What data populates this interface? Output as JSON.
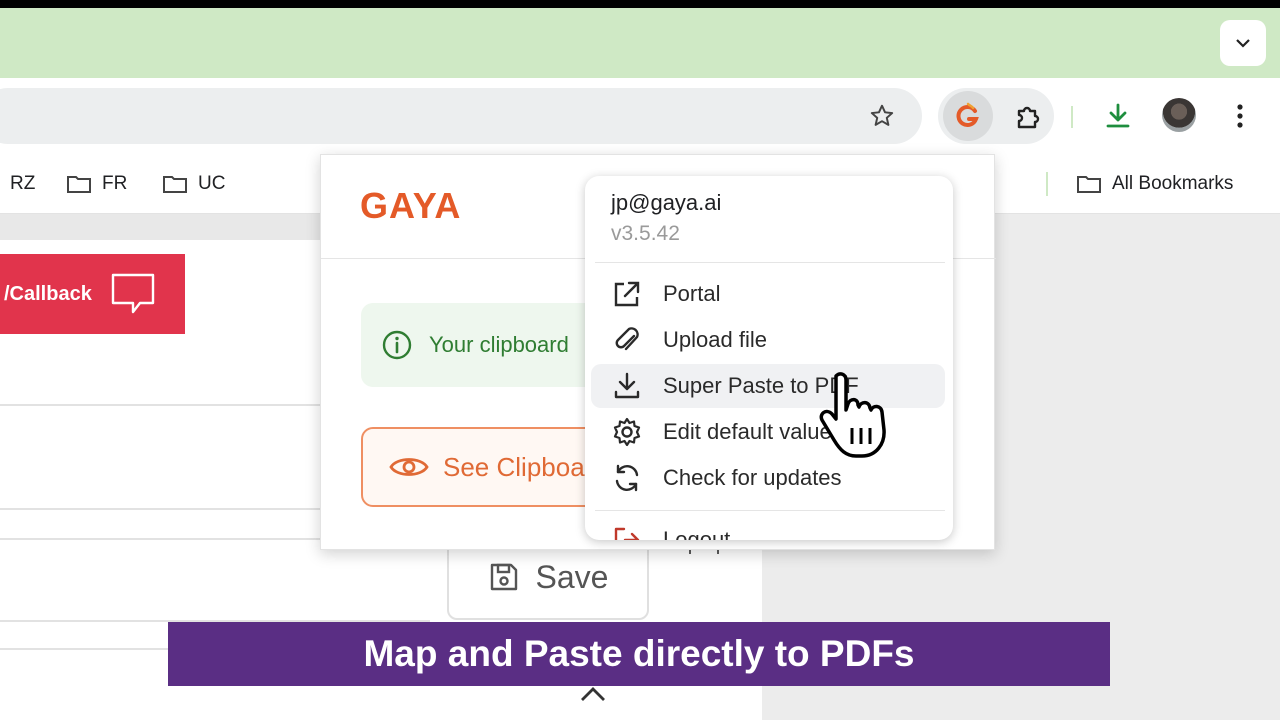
{
  "bookmarks": [
    {
      "label": "RZ"
    },
    {
      "label": "FR"
    },
    {
      "label": "UC"
    },
    {
      "label": "All Bookmarks"
    }
  ],
  "webpage": {
    "callback_label": "/Callback",
    "save_label": "Save",
    "partial_text": "ap Up"
  },
  "popup": {
    "logo": "GAYA",
    "info_text": "Your clipboard",
    "see_button_label": "See Clipboa"
  },
  "dropdown": {
    "email": "jp@gaya.ai",
    "version": "v3.5.42",
    "items": [
      {
        "label": "Portal",
        "icon": "external-link-icon"
      },
      {
        "label": "Upload file",
        "icon": "paperclip-icon"
      },
      {
        "label": "Super Paste to PDF",
        "icon": "download-icon"
      },
      {
        "label": "Edit default values",
        "icon": "gear-icon"
      },
      {
        "label": "Check for updates",
        "icon": "refresh-icon"
      },
      {
        "label": "Logout",
        "icon": "logout-icon"
      }
    ]
  },
  "caption": "Map and Paste directly to PDFs",
  "colors": {
    "titlebar": "#cfe9c5",
    "brand_orange": "#e45a28",
    "callback_red": "#e1344c",
    "caption_purple": "#5a2e84",
    "info_green": "#2f7d32",
    "download_green": "#1e8e3e"
  }
}
